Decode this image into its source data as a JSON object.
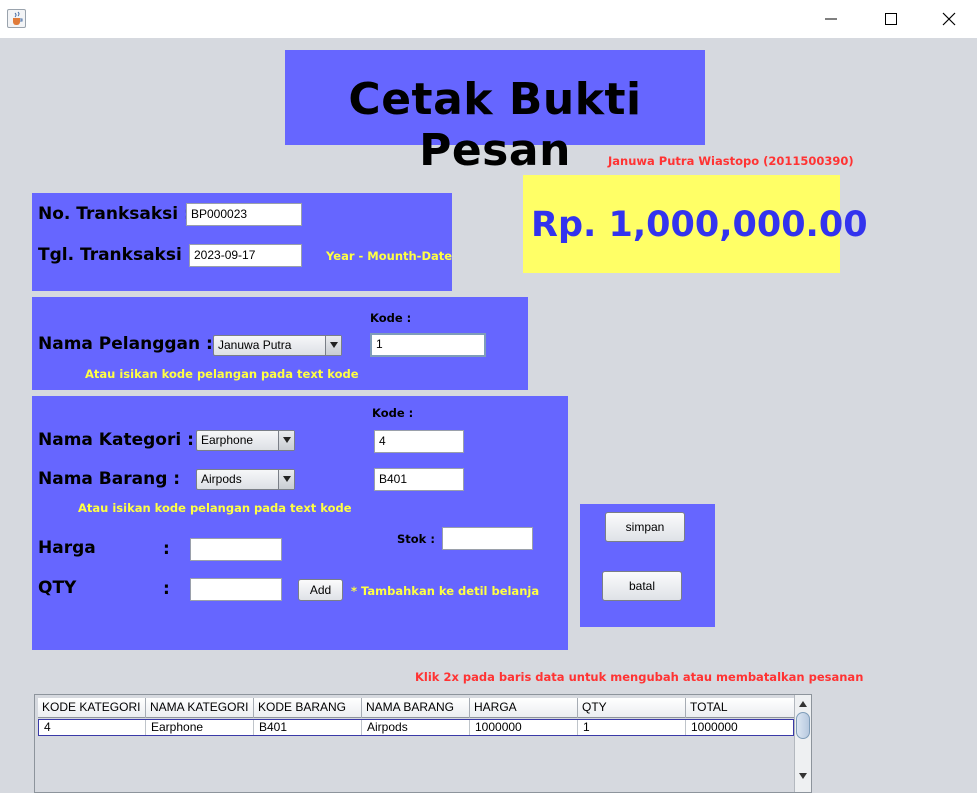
{
  "window": {
    "title_icon": "java-cup-icon"
  },
  "header": {
    "title": "Cetak Bukti Pesan"
  },
  "author": "Januwa Putra Wiastopo (2011500390)",
  "total": {
    "amount": "Rp. 1,000,000.00",
    "color": "#3333ee",
    "background": "#ffff66"
  },
  "transaksi": {
    "no_label": "No. Tranksaksi :",
    "no_value": "BP000023",
    "tgl_label": "Tgl. Tranksaksi :",
    "tgl_value": "2023-09-17",
    "date_hint": "Year - Mounth-Date"
  },
  "pelanggan": {
    "label": "Nama Pelanggan :",
    "selected": "Januwa Putra",
    "kode_label": "Kode :",
    "kode_value": "1",
    "hint": "Atau isikan kode pelangan pada text kode"
  },
  "barang": {
    "kode_label": "Kode :",
    "kategori_label": "Nama Kategori :",
    "kategori_selected": "Earphone",
    "kategori_kode": "4",
    "barang_label": "Nama Barang :",
    "barang_selected": "Airpods",
    "barang_kode": "B401",
    "hint": "Atau isikan kode pelangan pada text kode",
    "harga_label": "Harga",
    "harga_colon": ":",
    "harga_value": "",
    "stok_label": "Stok :",
    "stok_value": "",
    "qty_label": "QTY",
    "qty_colon": ":",
    "qty_value": "",
    "add_label": "Add",
    "add_hint": "* Tambahkan ke detil belanja"
  },
  "actions": {
    "simpan": "simpan",
    "batal": "batal"
  },
  "table_note": "Klik 2x pada baris data untuk mengubah atau membatalkan pesanan",
  "table": {
    "columns": [
      "KODE KATEGORI",
      "NAMA KATEGORI",
      "KODE BARANG",
      "NAMA BARANG",
      "HARGA",
      "QTY",
      "TOTAL"
    ],
    "rows": [
      [
        "4",
        "Earphone",
        "B401",
        "Airpods",
        "1000000",
        "1",
        "1000000"
      ]
    ]
  },
  "colors": {
    "panel": "#6666ff",
    "hint": "#ffff44",
    "note": "#ff3333"
  }
}
